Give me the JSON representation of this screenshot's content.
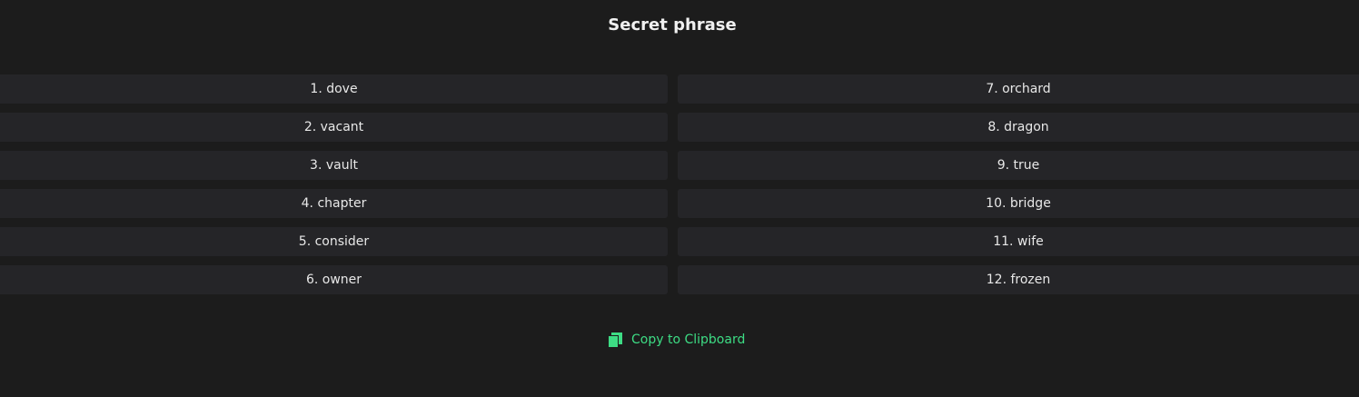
{
  "title": "Secret phrase",
  "words_left": [
    "1. dove",
    "2. vacant",
    "3. vault",
    "4. chapter",
    "5. consider",
    "6. owner"
  ],
  "words_right": [
    "7. orchard",
    "8. dragon",
    "9. true",
    "10. bridge",
    "11. wife",
    "12. frozen"
  ],
  "copy": {
    "label": "Copy to Clipboard",
    "icon": "copy-icon",
    "color": "#3ddc84"
  }
}
